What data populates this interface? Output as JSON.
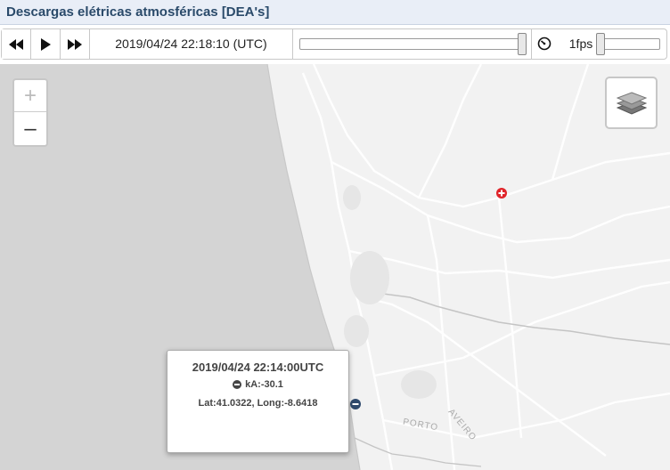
{
  "window": {
    "title": "Descargas elétricas atmosféricas [DEA's]"
  },
  "controls": {
    "rewind_icon": "rewind-icon",
    "play_icon": "play-icon",
    "forward_icon": "fast-forward-icon",
    "current_time": "2019/04/24 22:18:10 (UTC)",
    "time_slider_position": 1.0,
    "speed_icon": "speedometer-icon",
    "speed_label": "1fps",
    "speed_slider_position": 0.0
  },
  "map": {
    "zoom_in_label": "+",
    "zoom_out_label": "–",
    "layers_icon": "layers-icon",
    "labels": {
      "porto": "PORTO",
      "aveiro": "AVEIRO"
    },
    "markers": [
      {
        "type": "positive",
        "color": "#e0242a"
      },
      {
        "type": "negative",
        "color": "#2f4a6d"
      }
    ],
    "popup": {
      "time": "2019/04/24 22:14:00UTC",
      "ka": "kA:-30.1",
      "coords": "Lat:41.0322, Long:-8.6418"
    }
  },
  "colors": {
    "title": "#2a4a6a",
    "sea": "#d4d4d4",
    "land": "#f2f2f2"
  }
}
